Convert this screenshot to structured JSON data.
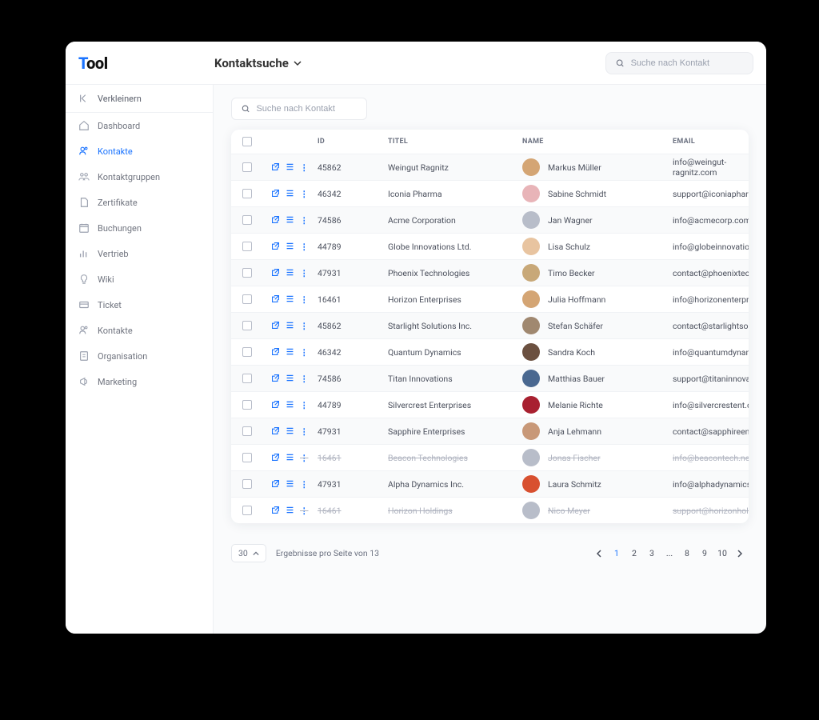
{
  "logo": {
    "pre": "T",
    "rest": "ool"
  },
  "header": {
    "title": "Kontaktsuche",
    "search_placeholder": "Suche nach Kontakt"
  },
  "sidebar": {
    "collapse_label": "Verkleinern",
    "items": [
      {
        "icon": "home",
        "label": "Dashboard"
      },
      {
        "icon": "users",
        "label": "Kontakte"
      },
      {
        "icon": "group",
        "label": "Kontaktgruppen"
      },
      {
        "icon": "file",
        "label": "Zertifikate"
      },
      {
        "icon": "cal",
        "label": "Buchungen"
      },
      {
        "icon": "chart",
        "label": "Vertrieb"
      },
      {
        "icon": "bulb",
        "label": "Wiki"
      },
      {
        "icon": "card",
        "label": "Ticket"
      },
      {
        "icon": "users",
        "label": "Kontakte"
      },
      {
        "icon": "doc",
        "label": "Organisation"
      },
      {
        "icon": "meg",
        "label": "Marketing"
      }
    ],
    "active_index": 1
  },
  "local_search_placeholder": "Suche nach Kontakt",
  "table": {
    "cols": {
      "id": "ID",
      "title": "TITEL",
      "name": "NAME",
      "email": "EMAIL"
    },
    "rows": [
      {
        "id": "45862",
        "title": "Weingut Ragnitz",
        "name": "Markus Müller",
        "email": "info@weingut-ragnitz.com",
        "avatar": "#d4a574",
        "disabled": false
      },
      {
        "id": "46342",
        "title": "Iconia Pharma",
        "name": "Sabine Schmidt",
        "email": "support@iconiapharma.com",
        "avatar": "#e8b4b8",
        "disabled": false
      },
      {
        "id": "74586",
        "title": "Acme Corporation",
        "name": "Jan Wagner",
        "email": "info@acmecorp.com",
        "avatar": "#b8bdc9",
        "disabled": false
      },
      {
        "id": "44789",
        "title": "Globe Innovations Ltd.",
        "name": "Lisa Schulz",
        "email": "info@globeinnovationsltd.com",
        "avatar": "#e8c4a0",
        "disabled": false
      },
      {
        "id": "47931",
        "title": "Phoenix Technologies",
        "name": "Timo  Becker",
        "email": "contact@phoenixtech.org",
        "avatar": "#c8a878",
        "disabled": false
      },
      {
        "id": "16461",
        "title": "Horizon Enterprises",
        "name": "Julia Hoffmann",
        "email": "info@horizonenterprises.net",
        "avatar": "#d4a574",
        "disabled": false
      },
      {
        "id": "45862",
        "title": "Starlight Solutions Inc.",
        "name": "Stefan Schäfer",
        "email": "contact@starlightsolutionsinc.com",
        "avatar": "#a08870",
        "disabled": false
      },
      {
        "id": "46342",
        "title": "Quantum Dynamics",
        "name": "Sandra Koch",
        "email": "info@quantumdynamics.biz",
        "avatar": "#6b5040",
        "disabled": false
      },
      {
        "id": "74586",
        "title": "Titan Innovations",
        "name": "Matthias Bauer",
        "email": "support@titaninnovations.org",
        "avatar": "#4a6890",
        "disabled": false
      },
      {
        "id": "44789",
        "title": "Silvercrest Enterprises",
        "name": "Melanie Richte",
        "email": "info@silvercrestent.com",
        "avatar": "#a82030",
        "disabled": false
      },
      {
        "id": "47931",
        "title": "Sapphire Enterprises",
        "name": "Anja Lehmann",
        "email": "contact@sapphireenterprises.org",
        "avatar": "#c89878",
        "disabled": false
      },
      {
        "id": "16461",
        "title": "Beacon Technologies",
        "name": "Jonas Fischer",
        "email": "info@beacontech.net",
        "avatar": "#b8bdc9",
        "disabled": true
      },
      {
        "id": "47931",
        "title": "Alpha Dynamics Inc.",
        "name": "Laura Schmitz",
        "email": "info@alphadynamicsinc.net",
        "avatar": "#d85030",
        "disabled": false
      },
      {
        "id": "16461",
        "title": "Horizon Holdings",
        "name": "Nico Meyer",
        "email": "support@horizonholdings.biz",
        "avatar": "#b8bdc9",
        "disabled": true
      }
    ]
  },
  "pager": {
    "page_size": "30",
    "info": "Ergebnisse pro Seite von 13",
    "pages": [
      "1",
      "2",
      "3",
      "...",
      "8",
      "9",
      "10"
    ],
    "active": 0
  }
}
